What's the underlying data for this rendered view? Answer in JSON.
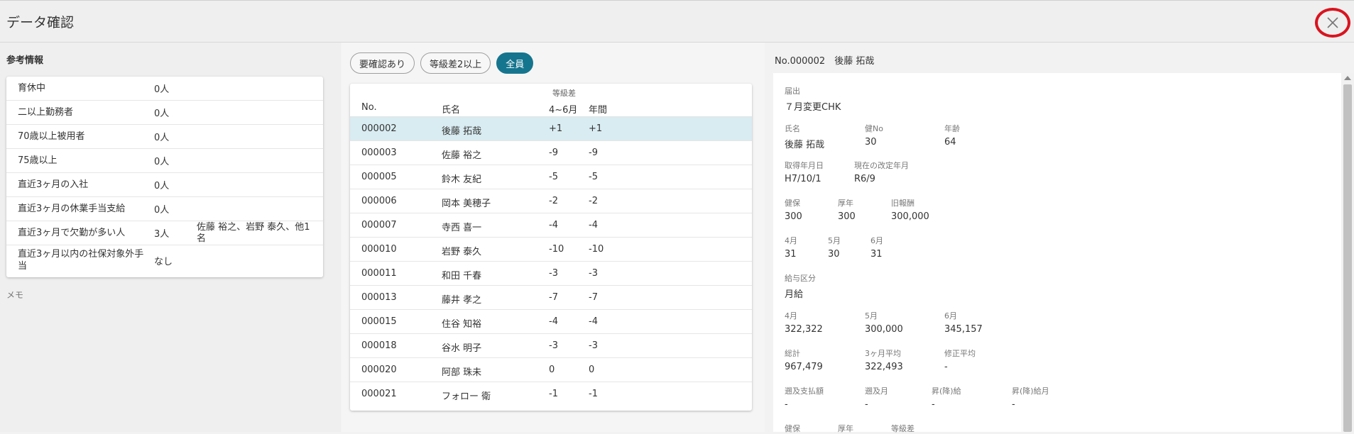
{
  "header": {
    "title": "データ確認"
  },
  "reference": {
    "title": "参考情報",
    "rows": [
      {
        "label": "育休中",
        "value": "0人",
        "note": ""
      },
      {
        "label": "二以上勤務者",
        "value": "0人",
        "note": ""
      },
      {
        "label": "70歳以上被用者",
        "value": "0人",
        "note": ""
      },
      {
        "label": "75歳以上",
        "value": "0人",
        "note": ""
      },
      {
        "label": "直近3ヶ月の入社",
        "value": "0人",
        "note": ""
      },
      {
        "label": "直近3ヶ月の休業手当支給",
        "value": "0人",
        "note": ""
      },
      {
        "label": "直近3ヶ月で欠勤が多い人",
        "value": "3人",
        "note": "佐藤 裕之、岩野 泰久、他1名"
      },
      {
        "label": "直近3ヶ月以内の社保対象外手当",
        "value": "なし",
        "note": ""
      }
    ],
    "memo_label": "メモ"
  },
  "filters": [
    {
      "label": "要確認あり"
    },
    {
      "label": "等級差2以上"
    },
    {
      "label": "全員"
    }
  ],
  "table": {
    "group_header": "等級差",
    "columns": [
      "No.",
      "氏名",
      "4~6月",
      "年間"
    ],
    "rows": [
      {
        "no": "000002",
        "name": "後藤 拓哉",
        "q": "+1",
        "year": "+1"
      },
      {
        "no": "000003",
        "name": "佐藤 裕之",
        "q": "-9",
        "year": "-9"
      },
      {
        "no": "000005",
        "name": "鈴木 友紀",
        "q": "-5",
        "year": "-5"
      },
      {
        "no": "000006",
        "name": "岡本 美穂子",
        "q": "-2",
        "year": "-2"
      },
      {
        "no": "000007",
        "name": "寺西 喜一",
        "q": "-4",
        "year": "-4"
      },
      {
        "no": "000010",
        "name": "岩野 泰久",
        "q": "-10",
        "year": "-10"
      },
      {
        "no": "000011",
        "name": "和田 千春",
        "q": "-3",
        "year": "-3"
      },
      {
        "no": "000013",
        "name": "藤井 孝之",
        "q": "-7",
        "year": "-7"
      },
      {
        "no": "000015",
        "name": "住谷 知裕",
        "q": "-4",
        "year": "-4"
      },
      {
        "no": "000018",
        "name": "谷水 明子",
        "q": "-3",
        "year": "-3"
      },
      {
        "no": "000020",
        "name": "阿部 珠未",
        "q": "0",
        "year": "0"
      },
      {
        "no": "000021",
        "name": "フォロー 衛",
        "q": "-1",
        "year": "-1"
      }
    ]
  },
  "detail": {
    "header": "No.000002　後藤 拓哉",
    "todokede": {
      "label": "届出",
      "value": "７月変更CHK"
    },
    "name": {
      "label": "氏名",
      "value": "後藤 拓哉"
    },
    "kenno": {
      "label": "健No",
      "value": "30"
    },
    "age": {
      "label": "年齢",
      "value": "64"
    },
    "acquired": {
      "label": "取得年月日",
      "value": "H7/10/1"
    },
    "revised": {
      "label": "現在の改定年月",
      "value": "R6/9"
    },
    "kenpo": {
      "label": "健保",
      "value": "300"
    },
    "kounen": {
      "label": "厚年",
      "value": "300"
    },
    "old_pay": {
      "label": "旧報酬",
      "value": "300,000"
    },
    "d_apr": {
      "label": "4月",
      "value": "31"
    },
    "d_may": {
      "label": "5月",
      "value": "30"
    },
    "d_jun": {
      "label": "6月",
      "value": "31"
    },
    "pay_type": {
      "label": "給与区分",
      "value": "月給"
    },
    "p_apr": {
      "label": "4月",
      "value": "322,322"
    },
    "p_may": {
      "label": "5月",
      "value": "300,000"
    },
    "p_jun": {
      "label": "6月",
      "value": "345,157"
    },
    "total": {
      "label": "総計",
      "value": "967,479"
    },
    "avg3": {
      "label": "3ヶ月平均",
      "value": "322,493"
    },
    "fix_avg": {
      "label": "修正平均",
      "value": "-"
    },
    "retro_amt": {
      "label": "遡及支払額",
      "value": "-"
    },
    "retro_month": {
      "label": "遡及月",
      "value": "-"
    },
    "raise": {
      "label": "昇(降)給",
      "value": "-"
    },
    "raise_month": {
      "label": "昇(降)給月",
      "value": "-"
    },
    "new_kenpo": {
      "label": "健保"
    },
    "new_kounen": {
      "label": "厚年"
    },
    "grade_diff": {
      "label": "等級差"
    }
  }
}
